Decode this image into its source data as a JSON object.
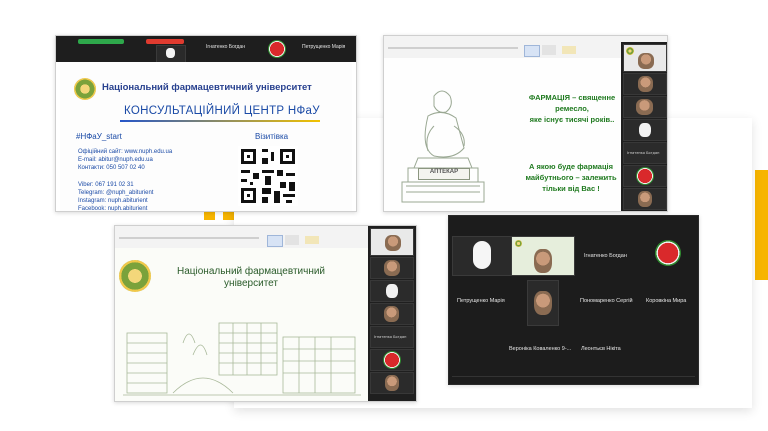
{
  "colors": {
    "accent_yellow": "#f7b500",
    "zoom_dark": "#1e1e1e",
    "nuph_blue": "#1a4aa6",
    "pharmacy_green": "#1f7a1f"
  },
  "icons": [
    "watermelon-avatar-icon",
    "university-logo-icon",
    "qr-code-icon",
    "cap-avatar-icon"
  ],
  "shot1": {
    "participants": [
      {
        "name": "Ігнатенко Богдан"
      },
      {
        "name": "Петрущенко Марія"
      }
    ],
    "slide": {
      "university": "Національний фармацевтичний університет",
      "heading": "КОНСУЛЬТАЦІЙНИЙ ЦЕНТР НФаУ",
      "hashtag": "#НФаУ_start",
      "card_label": "Візитівка",
      "info": [
        "Офіційний сайт: www.nuph.edu.ua",
        "E-mail: abitur@nuph.edu.ua",
        "Контакти: 050 507 02 40",
        "Viber: 067 191 02 31",
        "Telegram: @nuph_abiturient",
        "Instagram: nuph.abiturient",
        "Facebook: nuph.abiturient"
      ]
    }
  },
  "shot2": {
    "slide": {
      "line1": "ФАРМАЦІЯ – священне",
      "line2": "ремесло,",
      "line3": "яке існує тисячі років..",
      "line4": "А якою буде фармація",
      "line5": "майбутнього – залежить",
      "line6": "тільки від Вас !",
      "plaque": "АПТЕКАР"
    },
    "sidebar": [
      {
        "name": "Ігнатенко Богдан"
      }
    ]
  },
  "shot3": {
    "slide": {
      "title_line1": "Національний фармацевтичний",
      "title_line2": "університет"
    },
    "sidebar": [
      {
        "name": "Ігнатенко Богдан"
      }
    ]
  },
  "shot4": {
    "participants": [
      {
        "name": "Ігнатенко Богдан"
      },
      {
        "name": "Петрущенко Марія"
      },
      {
        "name": "Пономаренко Сергій"
      },
      {
        "name": "Коровкіна Мира"
      },
      {
        "name": "Вероніка Коваленко 9-..."
      },
      {
        "name": "Леонтьєв Нікіта"
      }
    ]
  }
}
